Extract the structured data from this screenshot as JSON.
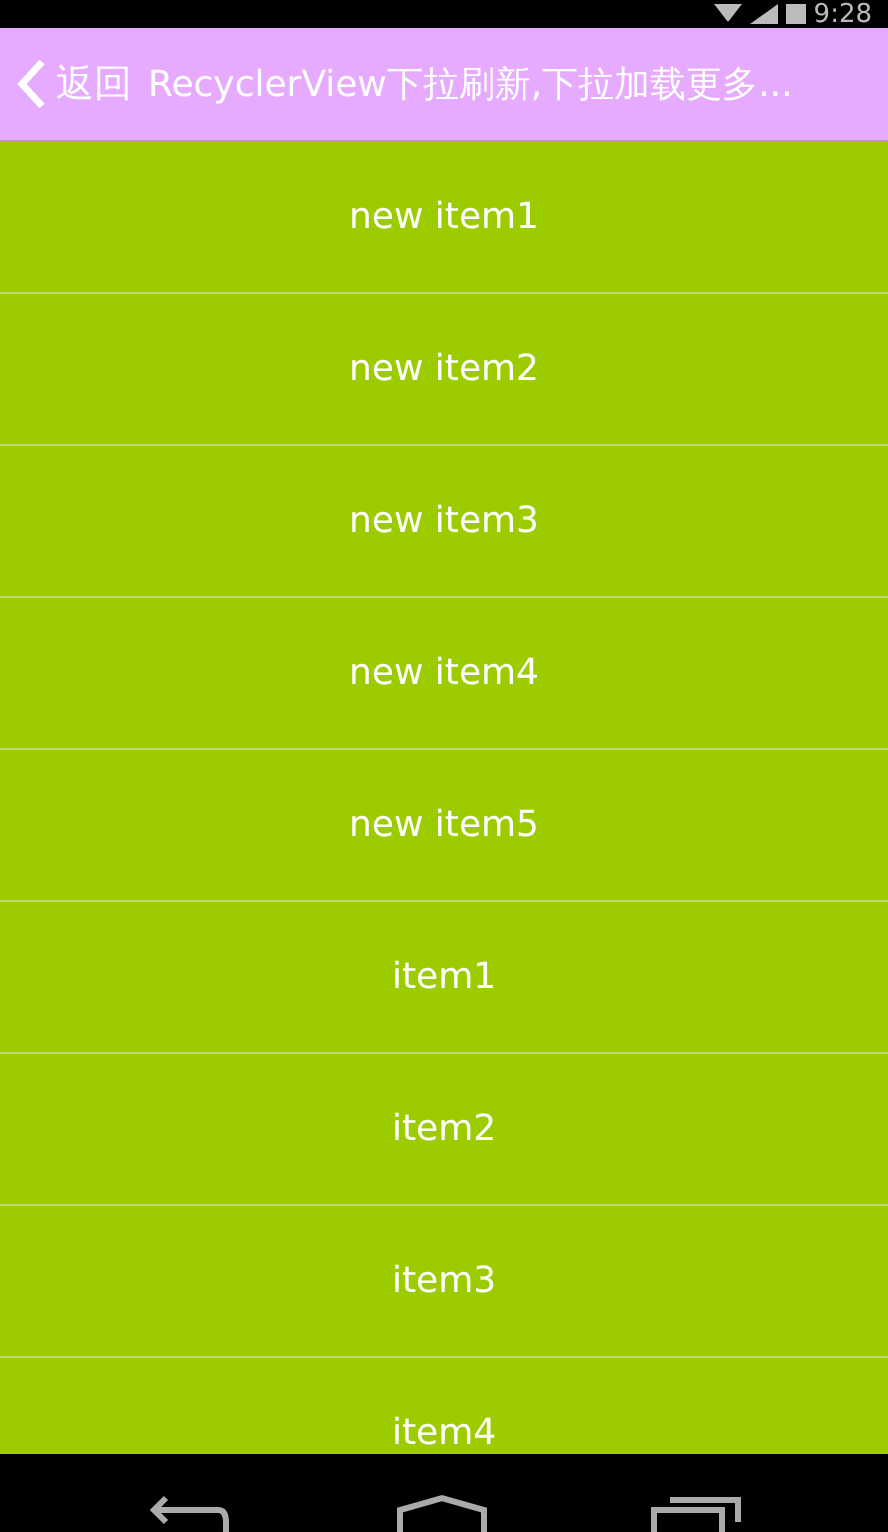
{
  "status_bar": {
    "time": "9:28"
  },
  "title_bar": {
    "back_label": "返回",
    "title": "RecyclerView下拉刷新,下拉加载更多..."
  },
  "list": {
    "items": [
      {
        "label": "new item1"
      },
      {
        "label": "new item2"
      },
      {
        "label": "new item3"
      },
      {
        "label": "new item4"
      },
      {
        "label": "new item5"
      },
      {
        "label": "item1"
      },
      {
        "label": "item2"
      },
      {
        "label": "item3"
      },
      {
        "label": "item4"
      }
    ]
  }
}
